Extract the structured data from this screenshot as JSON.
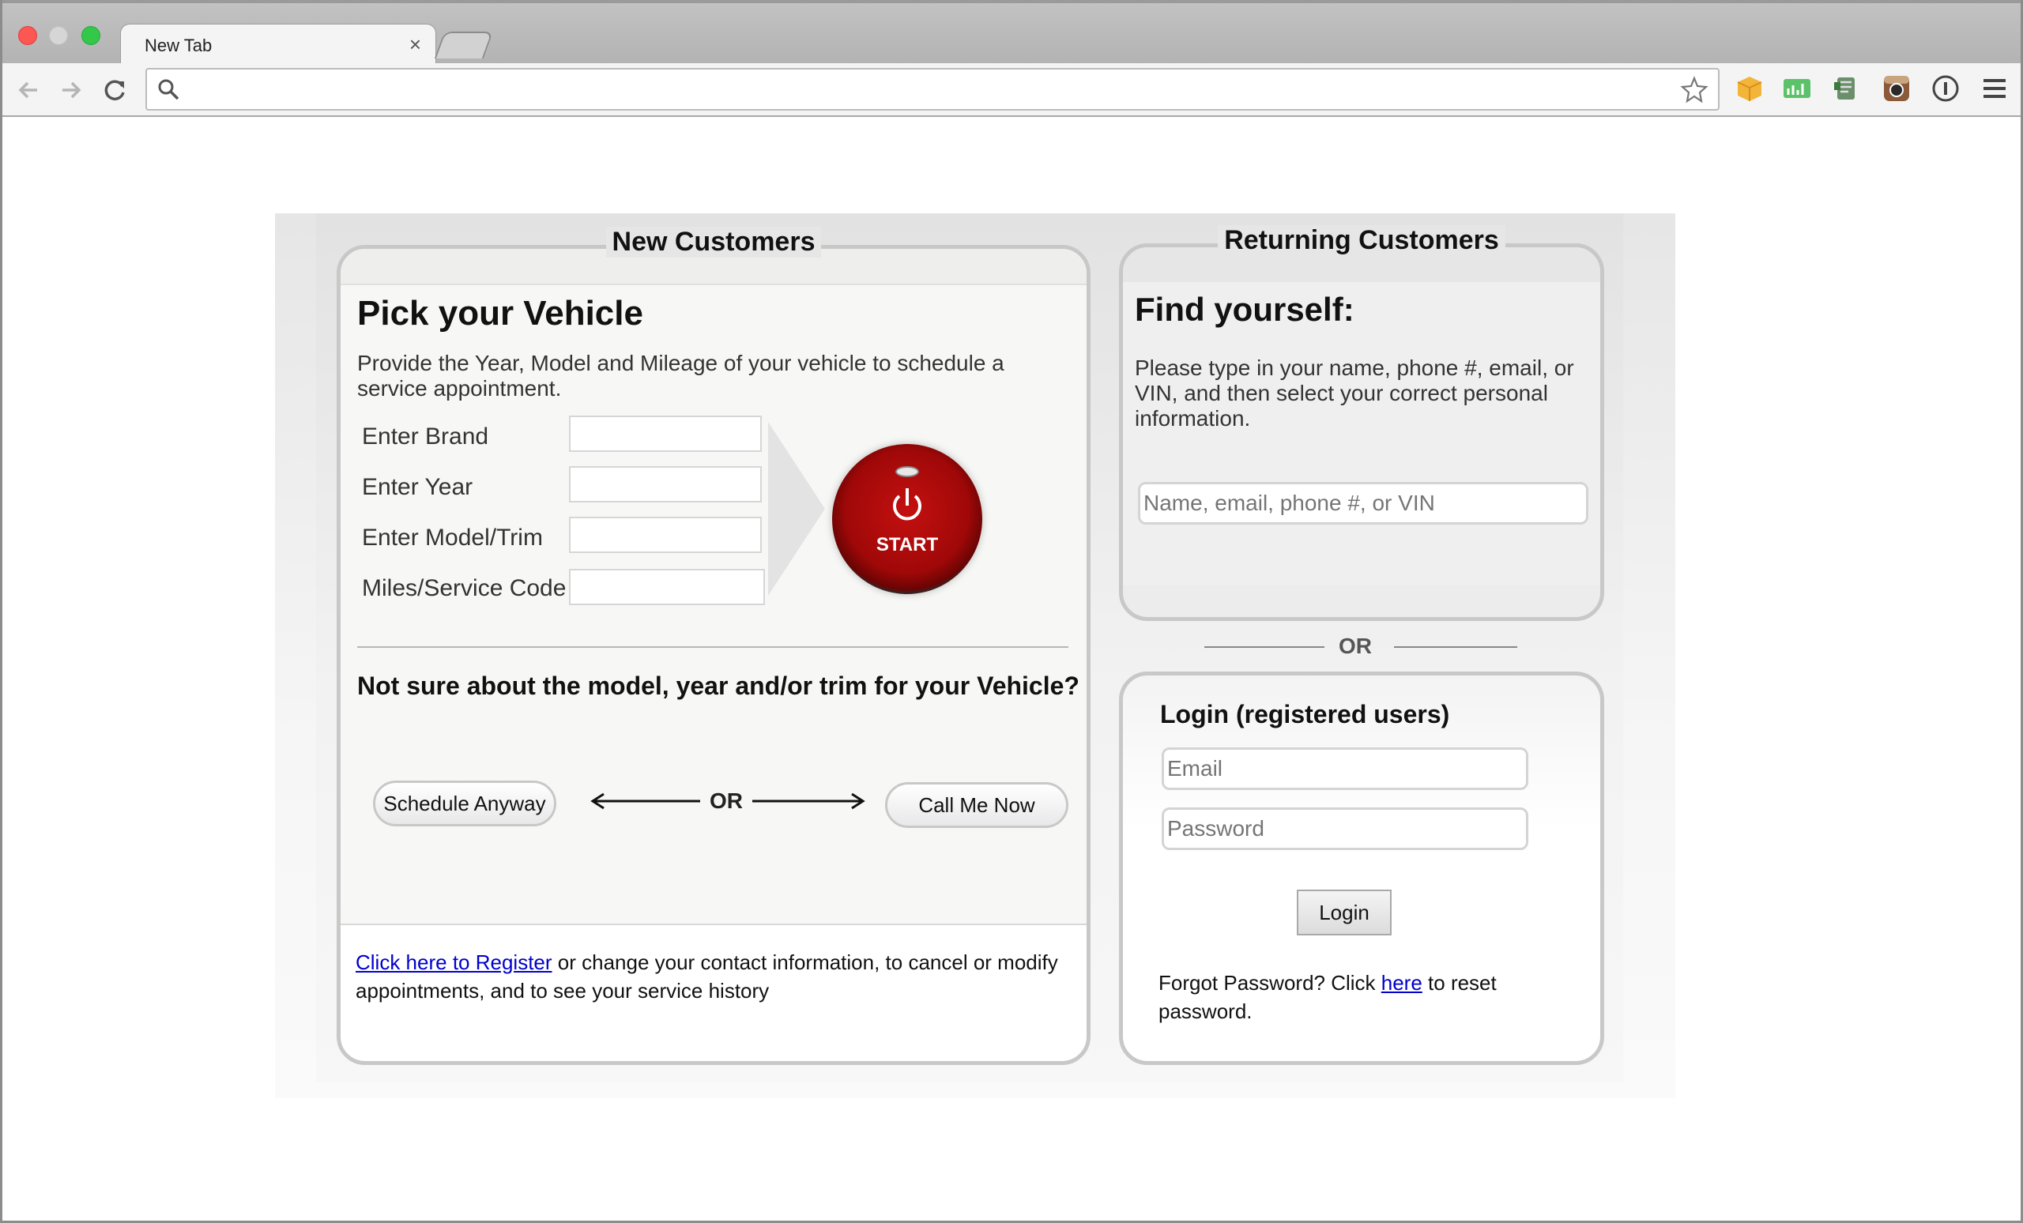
{
  "browser": {
    "tab_title": "New Tab",
    "tab_close": "×",
    "url": "",
    "colors": {
      "close": "#fc5753",
      "minimize": "#d6d6d6",
      "zoom": "#34c84a"
    },
    "icons": [
      "back-arrow-icon",
      "forward-arrow-icon",
      "reload-icon",
      "search-icon",
      "bookmark-star-icon",
      "extension-box-icon",
      "extension-chart-icon",
      "extension-evernote-icon",
      "extension-camera-icon",
      "extension-info-icon",
      "menu-icon"
    ]
  },
  "new_customers": {
    "legend": "New Customers",
    "heading": "Pick your Vehicle",
    "description": "Provide the Year, Model and Mileage of your vehicle to schedule a service appointment.",
    "fields": [
      {
        "label": "Enter Brand",
        "value": ""
      },
      {
        "label": "Enter Year",
        "value": ""
      },
      {
        "label": "Enter Model/Trim",
        "value": ""
      },
      {
        "label": "Miles/Service Code",
        "value": ""
      }
    ],
    "start_label": "START",
    "not_sure": "Not sure about the model, year and/or trim for your Vehicle?",
    "schedule_button": "Schedule Anyway",
    "or_text": "OR",
    "call_button": "Call Me Now",
    "register_link": "Click here to Register",
    "register_text": " or change your contact information, to cancel or modify appointments, and to see your service history"
  },
  "returning_customers": {
    "legend": "Returning Customers",
    "heading": "Find yourself:",
    "description": "Please type in your name, phone #, email, or VIN, and then select your correct personal information.",
    "search_placeholder": "Name, email, phone #, or VIN"
  },
  "separator_or": "OR",
  "login": {
    "heading": "Login (registered users)",
    "email_placeholder": "Email",
    "password_placeholder": "Password",
    "button": "Login",
    "forgot_prefix": "Forgot Password? Click ",
    "forgot_link": "here",
    "forgot_suffix": " to reset password."
  }
}
